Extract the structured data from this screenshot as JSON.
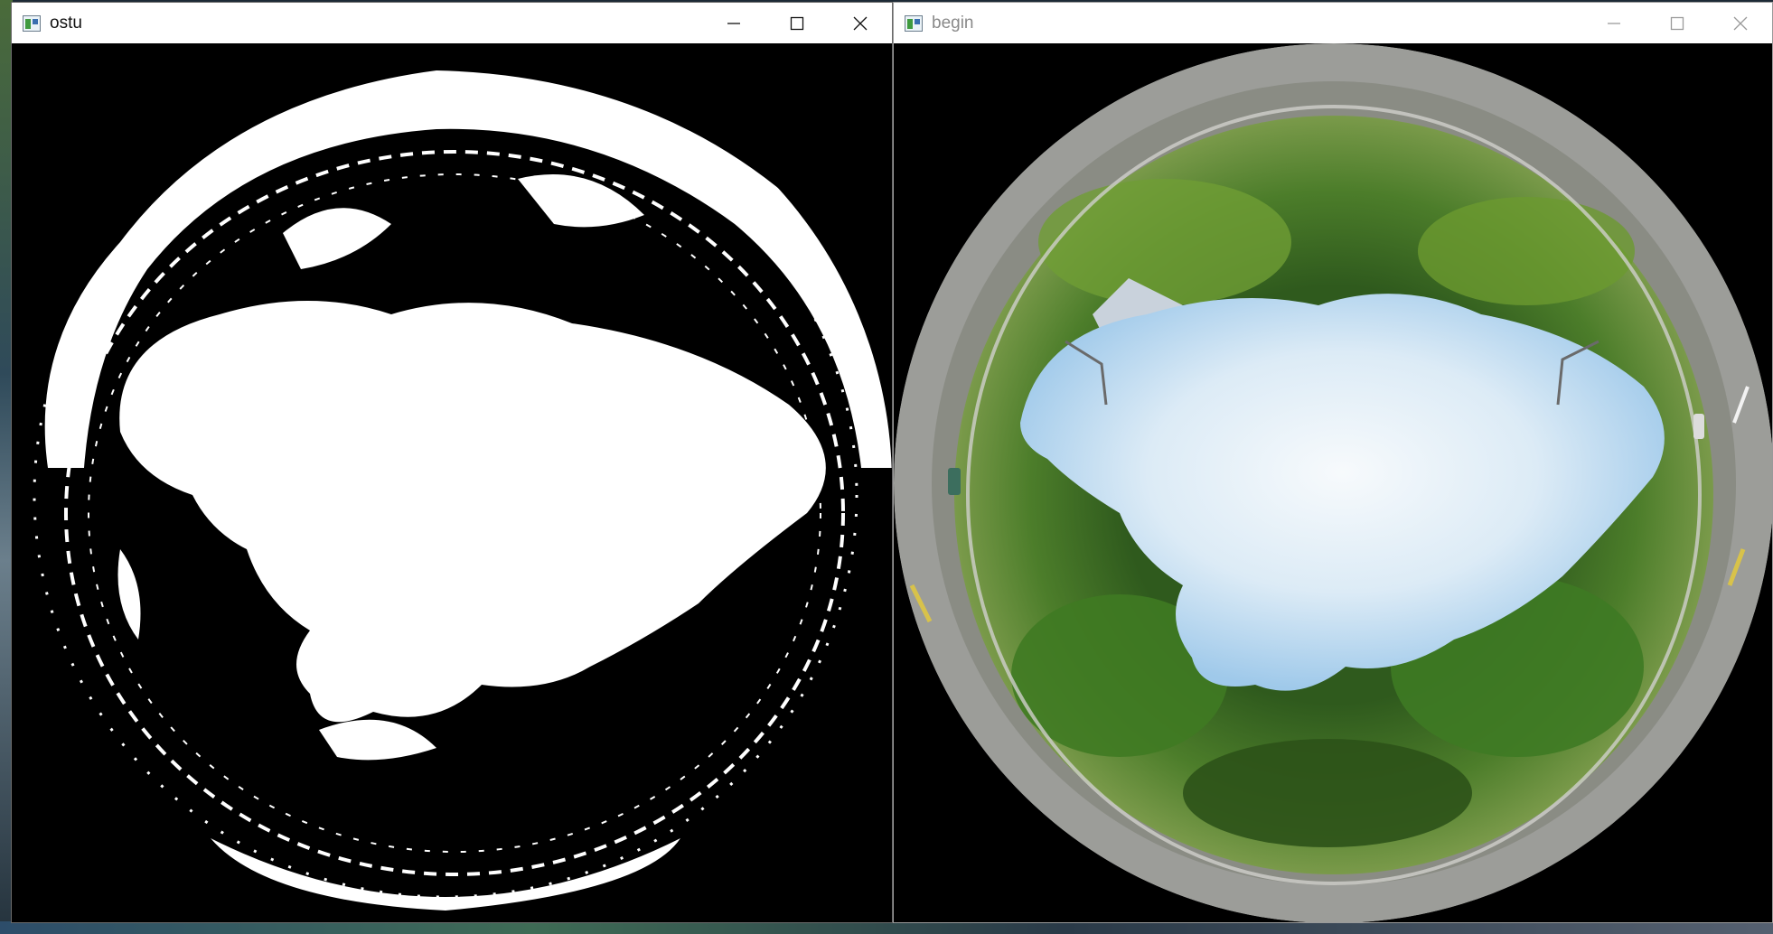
{
  "windows": [
    {
      "id": "ostu",
      "title": "ostu",
      "content": "otsu-threshold-binary-fisheye-image",
      "icons": [
        "app-icon",
        "minimize-icon",
        "maximize-icon",
        "close-icon"
      ],
      "active": true
    },
    {
      "id": "begin",
      "title": "begin",
      "content": "original-fisheye-photo",
      "icons": [
        "app-icon",
        "minimize-icon",
        "maximize-icon",
        "close-icon"
      ],
      "active": false
    }
  ],
  "colors": {
    "titlebar_bg": "#ffffff",
    "viewport_bg": "#000000",
    "inactive_title": "#8a8a8a",
    "sky_light": "#f4f8fb",
    "sky_blue": "#a9d0ee",
    "foliage_dark": "#1f3d16",
    "foliage_mid": "#3d6e24",
    "foliage_light": "#7fae3d",
    "road": "#9a9c9a"
  }
}
